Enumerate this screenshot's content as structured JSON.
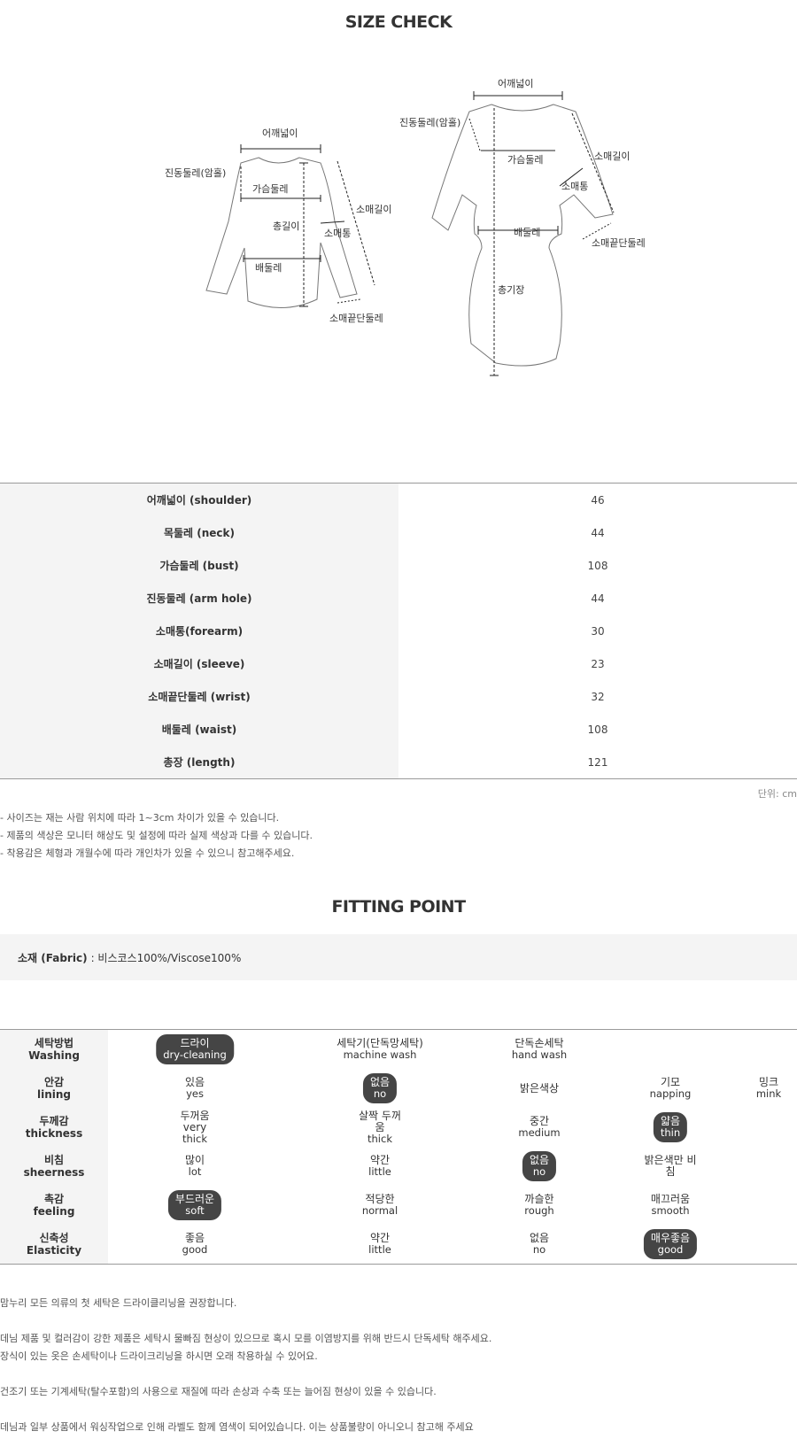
{
  "size_title": "SIZE CHECK",
  "diagram": {
    "shoulder": "어깨넓이",
    "armhole": "진동둘레(암홀)",
    "bust": "가슴둘레",
    "total_length": "총길이",
    "forearm": "소매통",
    "sleeve": "소매길이",
    "waist": "배둘레",
    "wrist": "소매끝단둘레",
    "dress_length": "총기장"
  },
  "measurements": [
    {
      "label": "어깨넓이 (shoulder)",
      "value": "46"
    },
    {
      "label": "목둘레 (neck)",
      "value": "44"
    },
    {
      "label": "가슴둘레 (bust)",
      "value": "108"
    },
    {
      "label": "진동둘레 (arm hole)",
      "value": "44"
    },
    {
      "label": "소매통(forearm)",
      "value": "30"
    },
    {
      "label": "소매길이 (sleeve)",
      "value": "23"
    },
    {
      "label": "소매끝단둘레 (wrist)",
      "value": "32"
    },
    {
      "label": "배둘레 (waist)",
      "value": "108"
    },
    {
      "label": "총장 (length)",
      "value": "121"
    }
  ],
  "unit": "단위: cm",
  "notes": [
    "- 사이즈는 재는 사람 위치에 따라 1~3cm 차이가 있을 수 있습니다.",
    "- 제품의 색상은 모니터 해상도 및 설정에 따라 실제 색상과 다를 수 있습니다.",
    "- 착용감은 체형과 개월수에 따라 개인차가 있을 수 있으니 참고해주세요."
  ],
  "fit_title": "FITTING POINT",
  "fabric": {
    "label": "소재 (Fabric)",
    "value": ": 비스코스100%/Viscose100%"
  },
  "fitting": [
    {
      "ko": "세탁방법",
      "en": "Washing",
      "options": [
        {
          "ko": "드라이",
          "en": "dry-cleaning",
          "selected": true
        },
        {
          "ko": "세탁기(단독망세탁)",
          "en": "machine wash",
          "selected": false
        },
        {
          "ko": "단독손세탁",
          "en": "hand wash",
          "selected": false
        }
      ]
    },
    {
      "ko": "안감",
      "en": "lining",
      "options": [
        {
          "ko": "있음",
          "en": "yes",
          "selected": false
        },
        {
          "ko": "없음",
          "en": "no",
          "selected": true
        },
        {
          "ko": "밝은색상",
          "en": "",
          "selected": false
        },
        {
          "ko": "기모",
          "en": "napping",
          "selected": false
        },
        {
          "ko": "밍크",
          "en": "mink",
          "selected": false
        }
      ]
    },
    {
      "ko": "두께감",
      "en": "thickness",
      "options": [
        {
          "ko": "두꺼움\nvery",
          "en": "thick",
          "selected": false
        },
        {
          "ko": "살짝 두꺼\n움",
          "en": "thick",
          "selected": false
        },
        {
          "ko": "중간",
          "en": "medium",
          "selected": false
        },
        {
          "ko": "얇음",
          "en": "thin",
          "selected": true
        }
      ]
    },
    {
      "ko": "비침",
      "en": "sheerness",
      "options": [
        {
          "ko": "많이",
          "en": "lot",
          "selected": false
        },
        {
          "ko": "약간",
          "en": "little",
          "selected": false
        },
        {
          "ko": "없음",
          "en": "no",
          "selected": true
        },
        {
          "ko": "밝은색만 비\n침",
          "en": "",
          "selected": false
        }
      ]
    },
    {
      "ko": "촉감",
      "en": "feeling",
      "options": [
        {
          "ko": "부드러운",
          "en": "soft",
          "selected": true
        },
        {
          "ko": "적당한",
          "en": "normal",
          "selected": false
        },
        {
          "ko": "까슬한",
          "en": "rough",
          "selected": false
        },
        {
          "ko": "매끄러움",
          "en": "smooth",
          "selected": false
        }
      ]
    },
    {
      "ko": "신축성",
      "en": "Elasticity",
      "options": [
        {
          "ko": "좋음",
          "en": "good",
          "selected": false
        },
        {
          "ko": "약간",
          "en": "little",
          "selected": false
        },
        {
          "ko": "없음",
          "en": "no",
          "selected": false
        },
        {
          "ko": "매우좋음",
          "en": "good",
          "selected": true
        }
      ]
    }
  ],
  "care_notes": [
    "맘누리 모든 의류의 첫 세탁은 드라이클리닝을 권장합니다.",
    "",
    "데님 제품 및 컬러감이 강한 제품은 세탁시 물빠짐 현상이 있으므로 혹시 모를 이염방지를 위해 반드시 단독세탁 해주세요.",
    "장식이 있는 옷은 손세탁이나 드라이크리닝을 하시면 오래 착용하실 수 있어요.",
    "",
    "건조기 또는 기계세탁(탈수포함)의 사용으로 재질에 따라 손상과 수축 또는 늘어짐 현상이 있을 수 있습니다.",
    "",
    "데님과 일부 상품에서 워싱작업으로 인해 라벨도 함께 염색이 되어있습니다. 이는 상품불량이 아니오니 참고해 주세요"
  ]
}
